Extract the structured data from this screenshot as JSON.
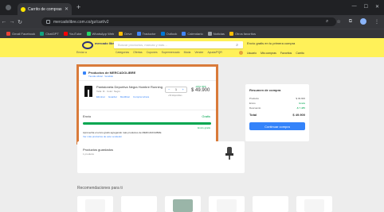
{
  "browser": {
    "tab_title": "Carrito de compras",
    "url": "mercadolibre.com.co/gz/cart/v2",
    "bookmarks": [
      {
        "label": "Gmail Facebook",
        "color": "#ea4335"
      },
      {
        "label": "ChatGPT",
        "color": "#10a37f"
      },
      {
        "label": "YouTube",
        "color": "#ff0000"
      },
      {
        "label": "WhatsApp Web",
        "color": "#25d366"
      },
      {
        "label": "Drive",
        "color": "#fbbc04"
      },
      {
        "label": "Traductor",
        "color": "#4285f4"
      },
      {
        "label": "Outlook",
        "color": "#0078d4"
      },
      {
        "label": "Calendario",
        "color": "#4285f4"
      },
      {
        "label": "Noticias",
        "color": "#9aa0a6"
      },
      {
        "label": "Otros favoritos",
        "color": "#fbbc04"
      }
    ]
  },
  "header": {
    "logo_text": "mercado libre",
    "search_placeholder": "Buscar productos, marcas y más…",
    "promo": "Envío gratis en tu primera compra",
    "location": "Enviar a",
    "categories": [
      "Categorías",
      "Ofertas",
      "Cupones",
      "Supermercado",
      "Moda",
      "Vender",
      "Ayuda/PQR"
    ],
    "user_links": [
      "Usuario",
      "Mis compras",
      "Favoritos",
      "Carrito"
    ]
  },
  "cart": {
    "seller": "Productos de MERCADOLIBRE",
    "seller_sub": "Tienda oficial · Vendido",
    "product_title": "Pantaloneta Deportiva Negra Hombre Running",
    "product_sub": "Talla: M · Color: Negro",
    "actions": [
      "Eliminar",
      "Guardar",
      "Modificar",
      "Comprar ahora"
    ],
    "quantity": "1",
    "stock": "+50 disponibles",
    "discount": "-15% OFF",
    "price": "$ 49.900",
    "shipping_label": "Envío",
    "shipping_value": "Gratis",
    "shipping_progress": 1.0,
    "progress_note": "Envío gratis",
    "shipping_message": "Aprovecha el envío gratis agregando más productos de MERCADOLIBRE",
    "shipping_link": "Ver más productos de este vendedor"
  },
  "summary": {
    "title": "Resumen de compra",
    "rows": [
      {
        "label": "Producto",
        "value": "$ 49.900"
      },
      {
        "label": "Envío",
        "value": "Gratis"
      },
      {
        "label": "Descuento",
        "value": "-$ 7.485"
      }
    ],
    "total_label": "Total",
    "total_value": "$ 49.900",
    "cta": "Continuar compra"
  },
  "saved": {
    "title": "Productos guardados",
    "count": "1 producto"
  },
  "recommendations": {
    "title": "Recomendaciones para ti",
    "thumb_colors": [
      "#f5f5f5",
      "#ffffff",
      "#9ab5a8",
      "#f5f5f5",
      "#ffffff",
      "#f5f5f5"
    ]
  }
}
